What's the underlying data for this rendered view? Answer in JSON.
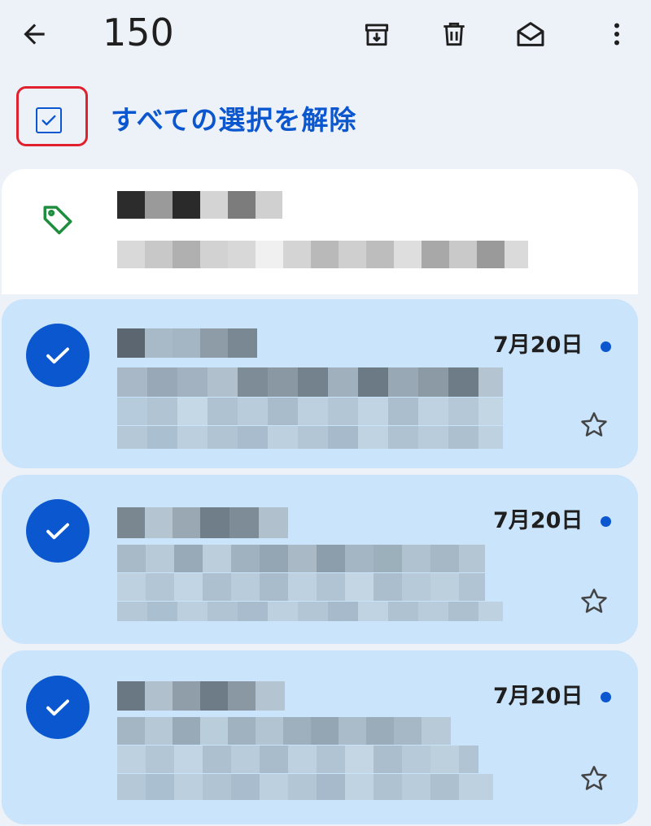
{
  "toolbar": {
    "selected_count": "150",
    "icons": [
      "back-arrow-icon",
      "archive-icon",
      "delete-icon",
      "mark-unread-icon",
      "more-vert-icon"
    ]
  },
  "selection": {
    "deselect_all_label": "すべての選択を解除",
    "checkbox_checked": true
  },
  "promo_row": {
    "icon": "tag-icon",
    "icon_color": "#1e8e3e"
  },
  "emails": [
    {
      "date": "7月20日",
      "selected": true,
      "unread": true,
      "starred": false
    },
    {
      "date": "7月20日",
      "selected": true,
      "unread": true,
      "starred": false
    },
    {
      "date": "7月20日",
      "selected": true,
      "unread": true,
      "starred": false
    }
  ],
  "colors": {
    "accent": "#0b57d0",
    "selected_row_bg": "#c9e4fb",
    "highlight_outline": "#e0202e",
    "background": "#edf1f8"
  }
}
